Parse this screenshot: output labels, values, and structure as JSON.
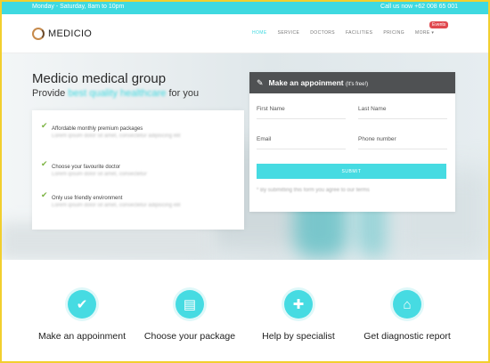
{
  "topbar": {
    "hours": "Monday - Saturday, 8am to 10pm",
    "call": "Call us now +62 008 65 001"
  },
  "brand": {
    "name": "MEDICIO"
  },
  "nav": {
    "items": [
      "HOME",
      "SERVICE",
      "DOCTORS",
      "FACILITIES",
      "PRICING",
      "MORE ▾"
    ],
    "badge": "Events"
  },
  "hero": {
    "title": "Medicio medical group",
    "subtitle_pre": "Provide",
    "subtitle_highlight": "best quality healthcare",
    "subtitle_post": "for you",
    "features": [
      {
        "title": "Affordable monthly premium packages",
        "desc": "Lorem ipsum dolor sit amet, consectetur adipiscing elit"
      },
      {
        "title": "Choose your favourite doctor",
        "desc": "Lorem ipsum dolor sit amet, consectetur"
      },
      {
        "title": "Only use friendly environment",
        "desc": "Lorem ipsum dolor sit amet, consectetur adipiscing elit"
      }
    ]
  },
  "form": {
    "title": "Make an appoinment",
    "free": "(It's free!)",
    "first_name": "First Name",
    "last_name": "Last Name",
    "email": "Email",
    "phone": "Phone number",
    "submit": "SUBMIT",
    "note": "* By submitting this form you agree to our terms"
  },
  "services": [
    {
      "label": "Make an appoinment",
      "icon": "check-icon"
    },
    {
      "label": "Choose your package",
      "icon": "package-icon"
    },
    {
      "label": "Help by specialist",
      "icon": "user-md-icon"
    },
    {
      "label": "Get diagnostic report",
      "icon": "hospital-icon"
    }
  ],
  "colors": {
    "accent": "#3fd9e0",
    "dark": "#4f5153",
    "check": "#7cb342",
    "frame": "#f2cf2e"
  }
}
